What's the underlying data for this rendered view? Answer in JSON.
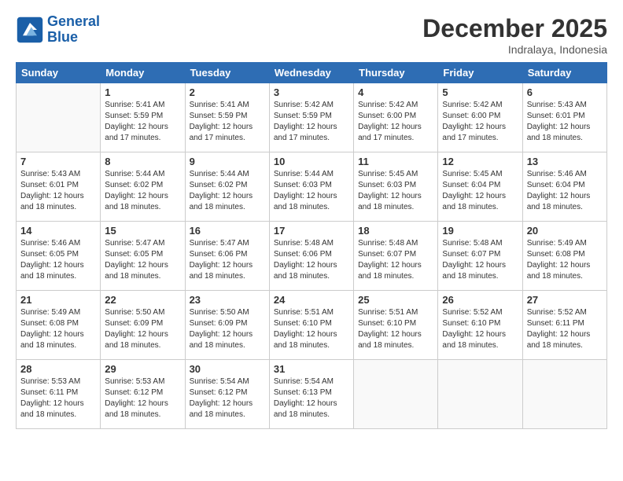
{
  "header": {
    "logo_line1": "General",
    "logo_line2": "Blue",
    "month": "December 2025",
    "location": "Indralaya, Indonesia"
  },
  "days_of_week": [
    "Sunday",
    "Monday",
    "Tuesday",
    "Wednesday",
    "Thursday",
    "Friday",
    "Saturday"
  ],
  "weeks": [
    [
      {
        "day": "",
        "sunrise": "",
        "sunset": "",
        "daylight": ""
      },
      {
        "day": "1",
        "sunrise": "Sunrise: 5:41 AM",
        "sunset": "Sunset: 5:59 PM",
        "daylight": "Daylight: 12 hours and 17 minutes."
      },
      {
        "day": "2",
        "sunrise": "Sunrise: 5:41 AM",
        "sunset": "Sunset: 5:59 PM",
        "daylight": "Daylight: 12 hours and 17 minutes."
      },
      {
        "day": "3",
        "sunrise": "Sunrise: 5:42 AM",
        "sunset": "Sunset: 5:59 PM",
        "daylight": "Daylight: 12 hours and 17 minutes."
      },
      {
        "day": "4",
        "sunrise": "Sunrise: 5:42 AM",
        "sunset": "Sunset: 6:00 PM",
        "daylight": "Daylight: 12 hours and 17 minutes."
      },
      {
        "day": "5",
        "sunrise": "Sunrise: 5:42 AM",
        "sunset": "Sunset: 6:00 PM",
        "daylight": "Daylight: 12 hours and 17 minutes."
      },
      {
        "day": "6",
        "sunrise": "Sunrise: 5:43 AM",
        "sunset": "Sunset: 6:01 PM",
        "daylight": "Daylight: 12 hours and 18 minutes."
      }
    ],
    [
      {
        "day": "7",
        "sunrise": "Sunrise: 5:43 AM",
        "sunset": "Sunset: 6:01 PM",
        "daylight": "Daylight: 12 hours and 18 minutes."
      },
      {
        "day": "8",
        "sunrise": "Sunrise: 5:44 AM",
        "sunset": "Sunset: 6:02 PM",
        "daylight": "Daylight: 12 hours and 18 minutes."
      },
      {
        "day": "9",
        "sunrise": "Sunrise: 5:44 AM",
        "sunset": "Sunset: 6:02 PM",
        "daylight": "Daylight: 12 hours and 18 minutes."
      },
      {
        "day": "10",
        "sunrise": "Sunrise: 5:44 AM",
        "sunset": "Sunset: 6:03 PM",
        "daylight": "Daylight: 12 hours and 18 minutes."
      },
      {
        "day": "11",
        "sunrise": "Sunrise: 5:45 AM",
        "sunset": "Sunset: 6:03 PM",
        "daylight": "Daylight: 12 hours and 18 minutes."
      },
      {
        "day": "12",
        "sunrise": "Sunrise: 5:45 AM",
        "sunset": "Sunset: 6:04 PM",
        "daylight": "Daylight: 12 hours and 18 minutes."
      },
      {
        "day": "13",
        "sunrise": "Sunrise: 5:46 AM",
        "sunset": "Sunset: 6:04 PM",
        "daylight": "Daylight: 12 hours and 18 minutes."
      }
    ],
    [
      {
        "day": "14",
        "sunrise": "Sunrise: 5:46 AM",
        "sunset": "Sunset: 6:05 PM",
        "daylight": "Daylight: 12 hours and 18 minutes."
      },
      {
        "day": "15",
        "sunrise": "Sunrise: 5:47 AM",
        "sunset": "Sunset: 6:05 PM",
        "daylight": "Daylight: 12 hours and 18 minutes."
      },
      {
        "day": "16",
        "sunrise": "Sunrise: 5:47 AM",
        "sunset": "Sunset: 6:06 PM",
        "daylight": "Daylight: 12 hours and 18 minutes."
      },
      {
        "day": "17",
        "sunrise": "Sunrise: 5:48 AM",
        "sunset": "Sunset: 6:06 PM",
        "daylight": "Daylight: 12 hours and 18 minutes."
      },
      {
        "day": "18",
        "sunrise": "Sunrise: 5:48 AM",
        "sunset": "Sunset: 6:07 PM",
        "daylight": "Daylight: 12 hours and 18 minutes."
      },
      {
        "day": "19",
        "sunrise": "Sunrise: 5:48 AM",
        "sunset": "Sunset: 6:07 PM",
        "daylight": "Daylight: 12 hours and 18 minutes."
      },
      {
        "day": "20",
        "sunrise": "Sunrise: 5:49 AM",
        "sunset": "Sunset: 6:08 PM",
        "daylight": "Daylight: 12 hours and 18 minutes."
      }
    ],
    [
      {
        "day": "21",
        "sunrise": "Sunrise: 5:49 AM",
        "sunset": "Sunset: 6:08 PM",
        "daylight": "Daylight: 12 hours and 18 minutes."
      },
      {
        "day": "22",
        "sunrise": "Sunrise: 5:50 AM",
        "sunset": "Sunset: 6:09 PM",
        "daylight": "Daylight: 12 hours and 18 minutes."
      },
      {
        "day": "23",
        "sunrise": "Sunrise: 5:50 AM",
        "sunset": "Sunset: 6:09 PM",
        "daylight": "Daylight: 12 hours and 18 minutes."
      },
      {
        "day": "24",
        "sunrise": "Sunrise: 5:51 AM",
        "sunset": "Sunset: 6:10 PM",
        "daylight": "Daylight: 12 hours and 18 minutes."
      },
      {
        "day": "25",
        "sunrise": "Sunrise: 5:51 AM",
        "sunset": "Sunset: 6:10 PM",
        "daylight": "Daylight: 12 hours and 18 minutes."
      },
      {
        "day": "26",
        "sunrise": "Sunrise: 5:52 AM",
        "sunset": "Sunset: 6:10 PM",
        "daylight": "Daylight: 12 hours and 18 minutes."
      },
      {
        "day": "27",
        "sunrise": "Sunrise: 5:52 AM",
        "sunset": "Sunset: 6:11 PM",
        "daylight": "Daylight: 12 hours and 18 minutes."
      }
    ],
    [
      {
        "day": "28",
        "sunrise": "Sunrise: 5:53 AM",
        "sunset": "Sunset: 6:11 PM",
        "daylight": "Daylight: 12 hours and 18 minutes."
      },
      {
        "day": "29",
        "sunrise": "Sunrise: 5:53 AM",
        "sunset": "Sunset: 6:12 PM",
        "daylight": "Daylight: 12 hours and 18 minutes."
      },
      {
        "day": "30",
        "sunrise": "Sunrise: 5:54 AM",
        "sunset": "Sunset: 6:12 PM",
        "daylight": "Daylight: 12 hours and 18 minutes."
      },
      {
        "day": "31",
        "sunrise": "Sunrise: 5:54 AM",
        "sunset": "Sunset: 6:13 PM",
        "daylight": "Daylight: 12 hours and 18 minutes."
      },
      {
        "day": "",
        "sunrise": "",
        "sunset": "",
        "daylight": ""
      },
      {
        "day": "",
        "sunrise": "",
        "sunset": "",
        "daylight": ""
      },
      {
        "day": "",
        "sunrise": "",
        "sunset": "",
        "daylight": ""
      }
    ]
  ]
}
